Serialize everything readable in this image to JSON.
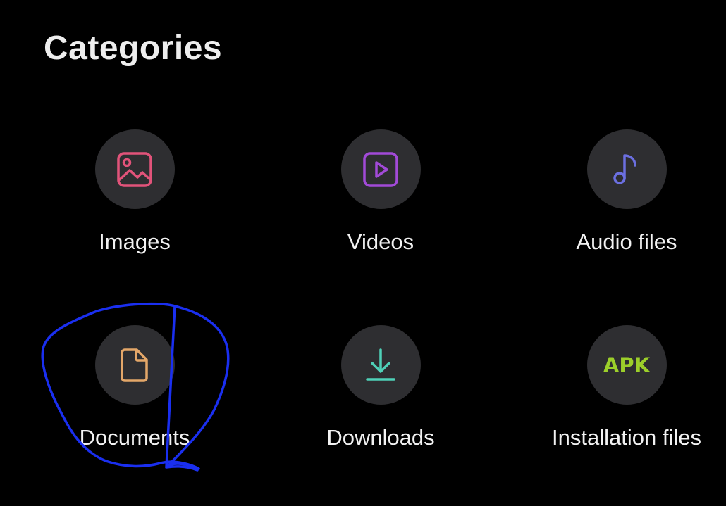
{
  "header": {
    "title": "Categories"
  },
  "categories": [
    {
      "label": "Images",
      "icon": "image-icon",
      "color": "#e2537a"
    },
    {
      "label": "Videos",
      "icon": "video-play-icon",
      "color": "#a24ad8"
    },
    {
      "label": "Audio files",
      "icon": "music-note-icon",
      "color": "#6b6fe0"
    },
    {
      "label": "Documents",
      "icon": "document-icon",
      "color": "#e4a769"
    },
    {
      "label": "Downloads",
      "icon": "download-icon",
      "color": "#4fd1b8"
    },
    {
      "label": "Installation files",
      "icon": "apk-icon",
      "icon_text": "APK",
      "color": "#9ccf2a"
    }
  ],
  "annotation": {
    "type": "hand-drawn circle around Documents",
    "color": "#1a2ff0"
  }
}
